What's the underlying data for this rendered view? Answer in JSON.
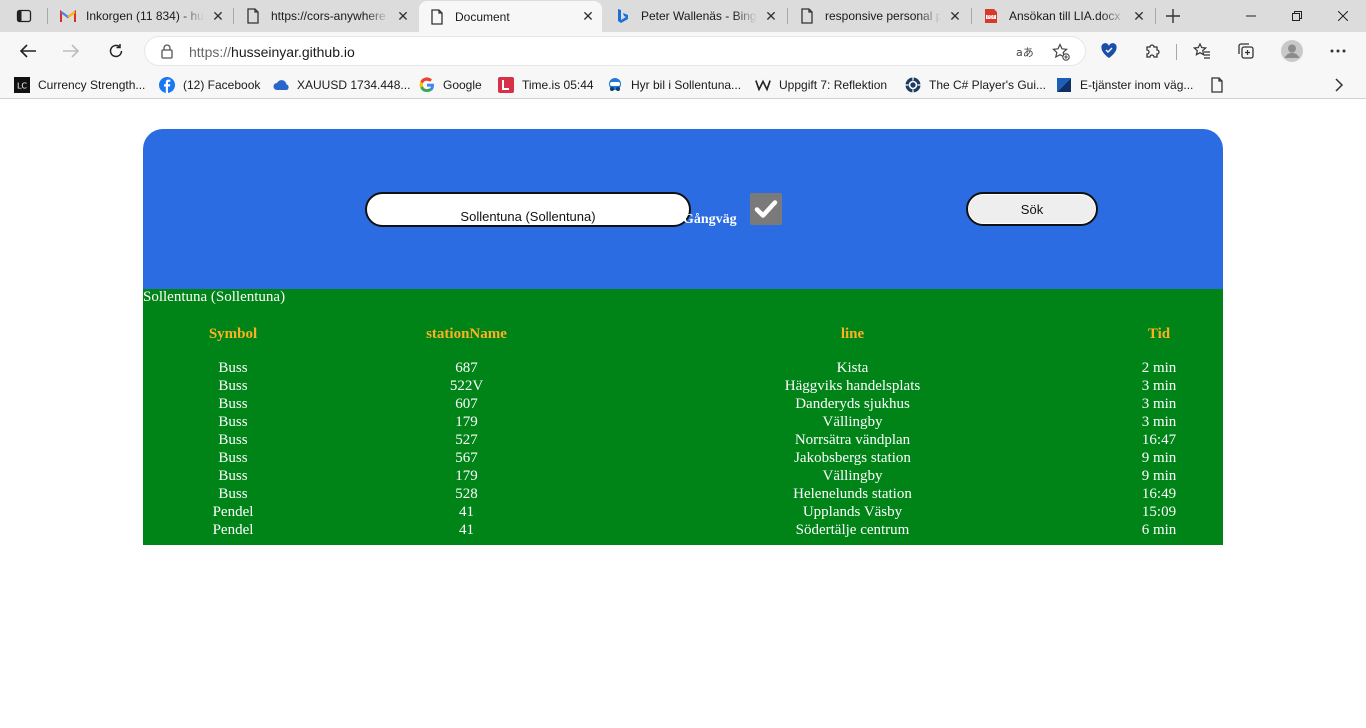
{
  "browser": {
    "tabs": [
      {
        "title": "Inkorgen (11 834) - hu",
        "icon": "gmail-icon",
        "active": false
      },
      {
        "title": "https://cors-anywhere",
        "icon": "page-icon",
        "active": false
      },
      {
        "title": "Document",
        "icon": "page-icon",
        "active": true
      },
      {
        "title": "Peter Wallenäs - Bing",
        "icon": "bing-icon",
        "active": false
      },
      {
        "title": "responsive personal p",
        "icon": "page-icon",
        "active": false
      },
      {
        "title": "Ansökan till LIA.docx (",
        "icon": "pdf-icon",
        "active": false
      }
    ],
    "address": {
      "scheme": "https://",
      "host": "husseinyar.github.io"
    },
    "bookmarks": [
      {
        "label": "Currency Strength...",
        "icon": "lc-icon"
      },
      {
        "label": "(12) Facebook",
        "icon": "facebook-icon"
      },
      {
        "label": "XAUUSD 1734.448...",
        "icon": "cloud-icon"
      },
      {
        "label": "Google",
        "icon": "google-icon"
      },
      {
        "label": "Time.is 05:44",
        "icon": "timeis-icon"
      },
      {
        "label": "Hyr bil i Sollentuna...",
        "icon": "car-icon"
      },
      {
        "label": "Uppgift 7: Reflektion",
        "icon": "w-icon"
      },
      {
        "label": "The C# Player's Gui...",
        "icon": "csharp-icon"
      },
      {
        "label": "E-tjänster inom väg...",
        "icon": "trafikverket-icon"
      }
    ],
    "colors": {
      "tabstrip": "#dcdcdc",
      "toolbar": "#f7f7f7"
    }
  },
  "search": {
    "input_value": "Sollentuna (Sollentuna)",
    "walk_label": "Gångväg",
    "walk_checked": true,
    "button_label": "Sök",
    "panel_color": "#2b6ce2"
  },
  "results": {
    "station_title": "Sollentuna (Sollentuna)",
    "headers": {
      "symbol": "Symbol",
      "station_name": "stationName",
      "line": "line",
      "time": "Tid"
    },
    "rows": [
      {
        "symbol": "Buss",
        "station_name": "687",
        "line": "Kista",
        "time": "2 min"
      },
      {
        "symbol": "Buss",
        "station_name": "522V",
        "line": "Häggviks handelsplats",
        "time": "3 min"
      },
      {
        "symbol": "Buss",
        "station_name": "607",
        "line": "Danderyds sjukhus",
        "time": "3 min"
      },
      {
        "symbol": "Buss",
        "station_name": "179",
        "line": "Vällingby",
        "time": "3 min"
      },
      {
        "symbol": "Buss",
        "station_name": "527",
        "line": "Norrsätra vändplan",
        "time": "16:47"
      },
      {
        "symbol": "Buss",
        "station_name": "567",
        "line": "Jakobsbergs station",
        "time": "9 min"
      },
      {
        "symbol": "Buss",
        "station_name": "179",
        "line": "Vällingby",
        "time": "9 min"
      },
      {
        "symbol": "Buss",
        "station_name": "528",
        "line": "Helenelunds station",
        "time": "16:49"
      },
      {
        "symbol": "Pendel",
        "station_name": "41",
        "line": "Upplands Väsby",
        "time": "15:09"
      },
      {
        "symbol": "Pendel",
        "station_name": "41",
        "line": "Södertälje centrum",
        "time": "6 min"
      }
    ],
    "panel_color": "#008418",
    "header_color": "#ffb020"
  }
}
